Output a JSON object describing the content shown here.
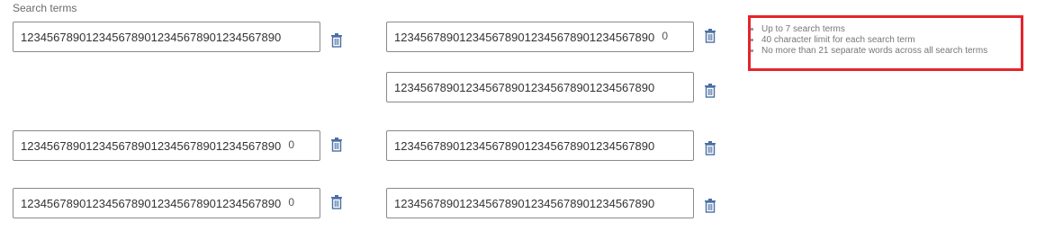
{
  "section": {
    "label": "Search terms"
  },
  "fields": {
    "r1c1": {
      "value": "1234567890123456789012345678901234567890",
      "count": ""
    },
    "r1c2": {
      "value": "1234567890123456789012345678901234567890",
      "count": "0"
    },
    "r2c2": {
      "value": "1234567890123456789012345678901234567890",
      "count": ""
    },
    "r3c1": {
      "value": "1234567890123456789012345678901234567890",
      "count": "0"
    },
    "r3c2": {
      "value": "1234567890123456789012345678901234567890",
      "count": ""
    },
    "r4c1": {
      "value": "1234567890123456789012345678901234567890",
      "count": "0"
    },
    "r4c2": {
      "value": "1234567890123456789012345678901234567890",
      "count": ""
    }
  },
  "tips": {
    "items": [
      "Up to 7 search terms",
      "40 character limit for each search term",
      "No more than 21 separate words across all search terms"
    ]
  },
  "colors": {
    "trash_icon": "#4a6fa5",
    "highlight_border": "#e5242c"
  },
  "icons": {
    "delete": "trash-icon",
    "bullet": "bullet-dot"
  }
}
